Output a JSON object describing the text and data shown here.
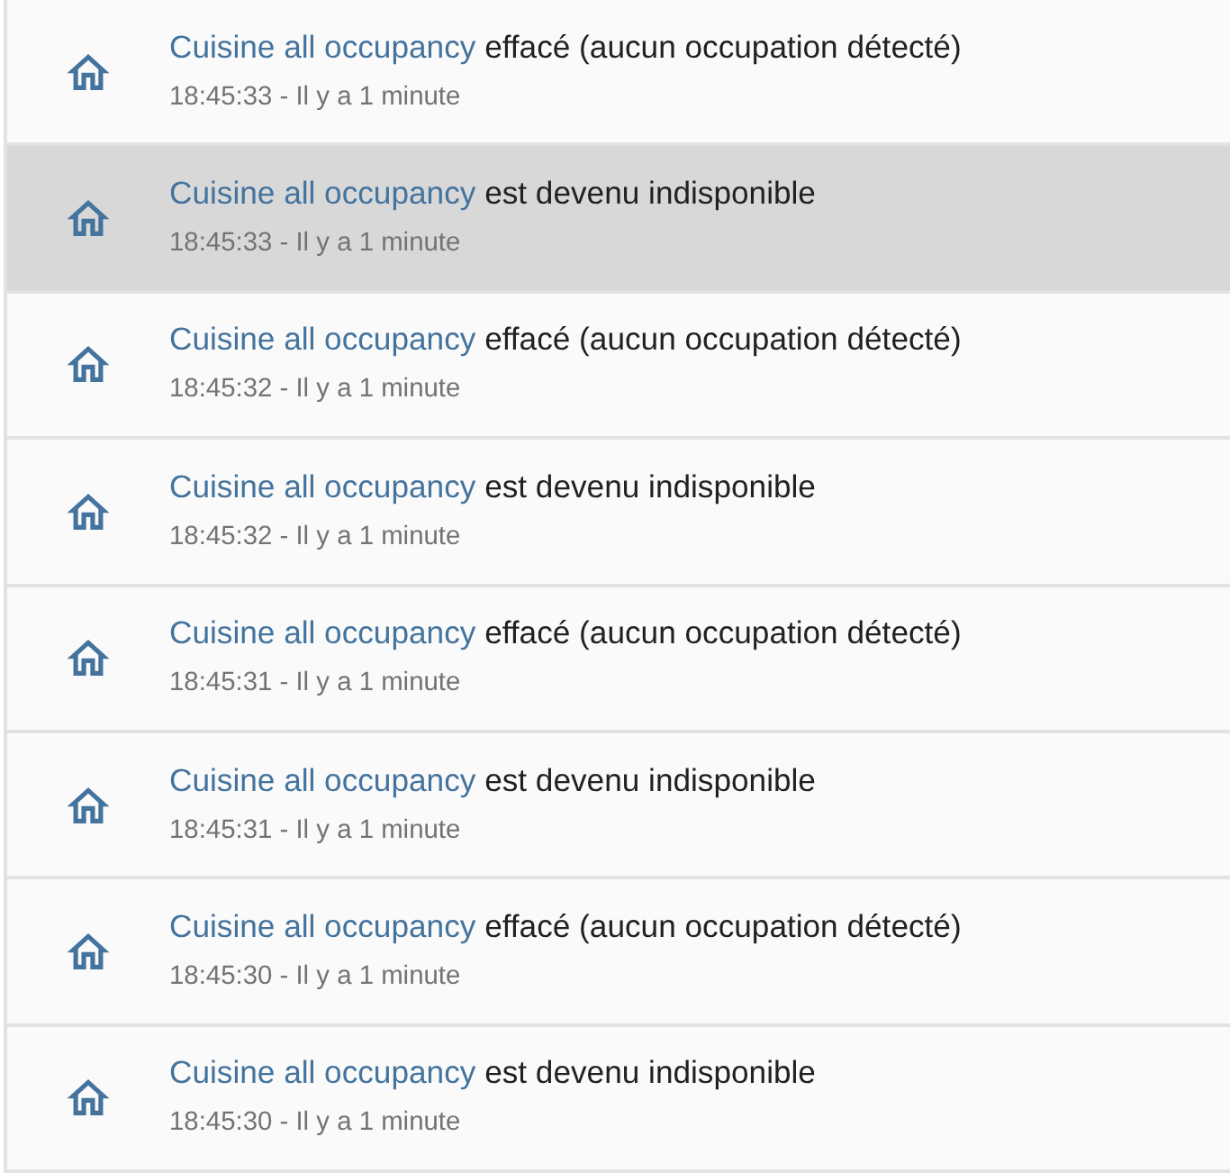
{
  "logbook": {
    "entries": [
      {
        "entity": "Cuisine all occupancy",
        "message": "effacé (aucun occupation détecté)",
        "time": "18:45:33 - Il y a 1 minute",
        "highlighted": false
      },
      {
        "entity": "Cuisine all occupancy",
        "message": "est devenu indisponible",
        "time": "18:45:33 - Il y a 1 minute",
        "highlighted": true
      },
      {
        "entity": "Cuisine all occupancy",
        "message": "effacé (aucun occupation détecté)",
        "time": "18:45:32 - Il y a 1 minute",
        "highlighted": false
      },
      {
        "entity": "Cuisine all occupancy",
        "message": "est devenu indisponible",
        "time": "18:45:32 - Il y a 1 minute",
        "highlighted": false
      },
      {
        "entity": "Cuisine all occupancy",
        "message": "effacé (aucun occupation détecté)",
        "time": "18:45:31 - Il y a 1 minute",
        "highlighted": false
      },
      {
        "entity": "Cuisine all occupancy",
        "message": "est devenu indisponible",
        "time": "18:45:31 - Il y a 1 minute",
        "highlighted": false
      },
      {
        "entity": "Cuisine all occupancy",
        "message": "effacé (aucun occupation détecté)",
        "time": "18:45:30 - Il y a 1 minute",
        "highlighted": false
      },
      {
        "entity": "Cuisine all occupancy",
        "message": "est devenu indisponible",
        "time": "18:45:30 - Il y a 1 minute",
        "highlighted": false
      }
    ]
  }
}
